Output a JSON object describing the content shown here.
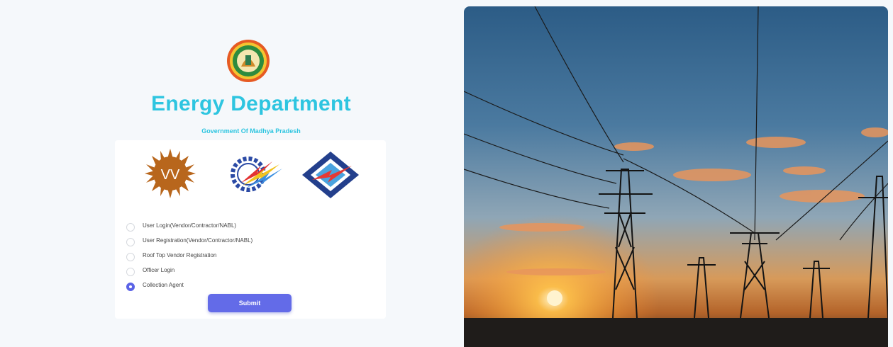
{
  "header": {
    "title": "Energy Department",
    "subtitle": "Government Of Madhya Pradesh"
  },
  "logos": {
    "emblem_icon": "mp-government-emblem",
    "discom_logos": [
      "sun-vv-logo-icon",
      "gear-lightning-logo-icon",
      "diamond-lightning-logo-icon"
    ],
    "vv_logo_text": "VV"
  },
  "login_options": [
    {
      "label": "User Login(Vendor/Contractor/NABL)",
      "selected": false
    },
    {
      "label": "User Registration(Vendor/Contractor/NABL)",
      "selected": false
    },
    {
      "label": "Roof Top Vendor Registration",
      "selected": false
    },
    {
      "label": "Officer Login",
      "selected": false
    },
    {
      "label": "Collection Agent",
      "selected": true
    }
  ],
  "submit_label": "Submit",
  "colors": {
    "title": "#2ec5e0",
    "accent": "#636be8",
    "page_background": "#f5f8fb"
  },
  "hero_image": "power-transmission-towers-at-sunset"
}
